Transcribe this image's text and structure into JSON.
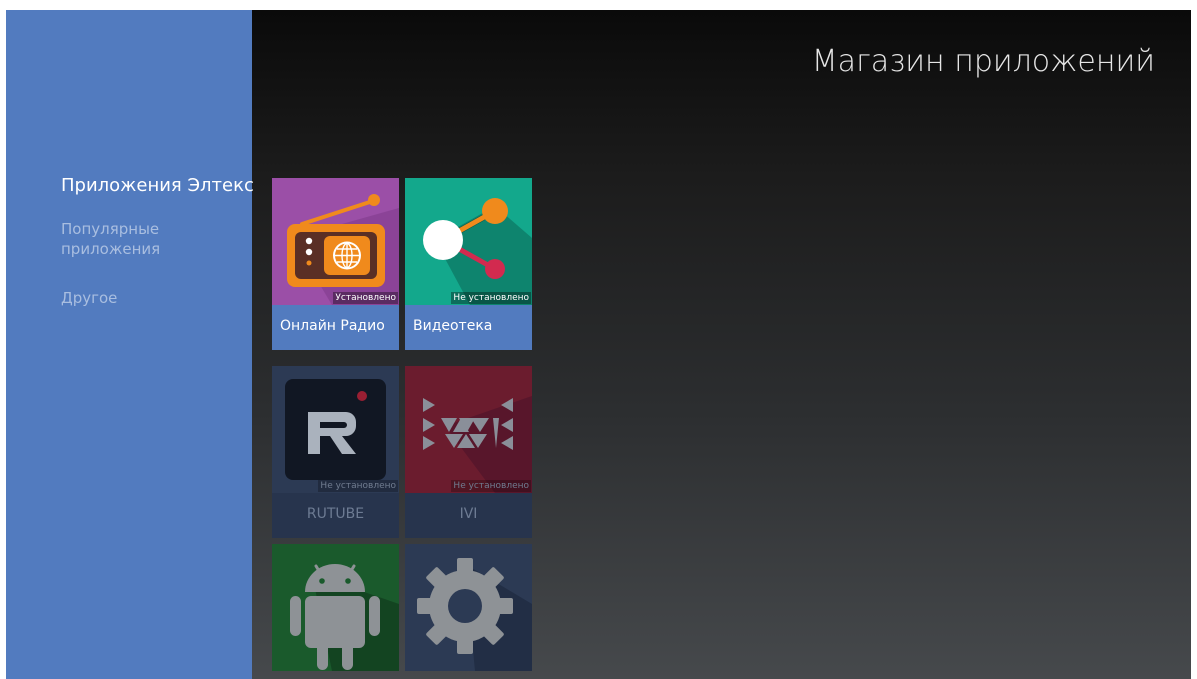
{
  "header": {
    "title": "Магазин приложений"
  },
  "sidebar": {
    "items": [
      {
        "label": "Приложения Элтекс"
      },
      {
        "label": "Популярные приложения"
      },
      {
        "label": "Другое"
      }
    ]
  },
  "apps": [
    {
      "name": "Онлайн Радио",
      "status": "Установлено",
      "icon": "radio-icon"
    },
    {
      "name": "Видеотека",
      "status": "Не установлено",
      "icon": "share-icon"
    },
    {
      "name": "RUTUBE",
      "status": "Не установлено",
      "icon": "rutube-logo"
    },
    {
      "name": "IVI",
      "status": "Не установлено",
      "icon": "ivi-logo"
    },
    {
      "name": "",
      "status": "",
      "icon": "android-icon"
    },
    {
      "name": "",
      "status": "",
      "icon": "gear-icon"
    }
  ],
  "colors": {
    "sidebar": "#527bbf",
    "tile_label": "#527bbf",
    "radio_bg": "#9b4fa7",
    "videoteka_bg": "#13a88c",
    "rutube_bg": "#263042",
    "ivi_bg": "#6b1c2e",
    "android_bg": "#1a5a2c",
    "settings_bg": "#263042"
  }
}
